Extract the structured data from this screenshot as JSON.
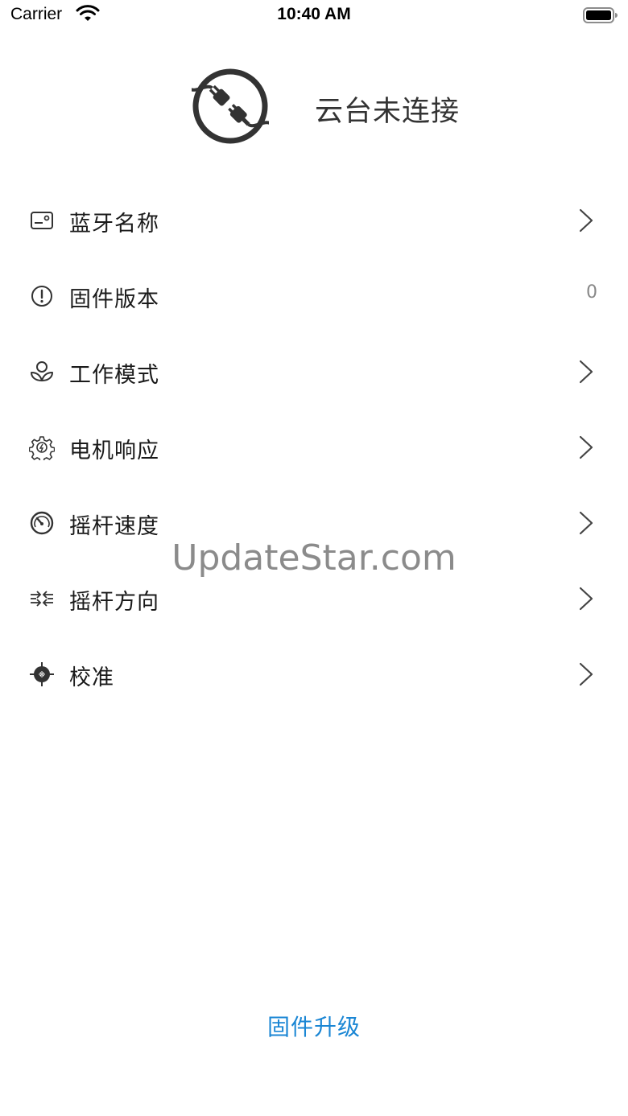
{
  "status_bar": {
    "carrier": "Carrier",
    "time": "10:40 AM",
    "wifi_icon": "wifi-icon",
    "battery_icon": "battery-icon"
  },
  "header": {
    "icon": "plug-disconnected-icon",
    "title": "云台未连接"
  },
  "menu": {
    "items": [
      {
        "label": "蓝牙名称",
        "icon": "bluetooth-name-icon",
        "has_chevron": true
      },
      {
        "label": "固件版本",
        "icon": "info-icon",
        "value": "0",
        "has_chevron": false
      },
      {
        "label": "工作模式",
        "icon": "work-mode-icon",
        "has_chevron": true
      },
      {
        "label": "电机响应",
        "icon": "motor-gear-icon",
        "has_chevron": true
      },
      {
        "label": "摇杆速度",
        "icon": "speedometer-icon",
        "has_chevron": true
      },
      {
        "label": "摇杆方向",
        "icon": "direction-arrows-icon",
        "has_chevron": true
      },
      {
        "label": "校准",
        "icon": "calibration-target-icon",
        "has_chevron": true
      }
    ]
  },
  "watermark": "UpdateStar.com",
  "footer": {
    "upgrade_label": "固件升级"
  },
  "colors": {
    "accent": "#1a86d4",
    "text": "#1a1a1a",
    "value_text": "#888888",
    "icon": "#333333"
  }
}
